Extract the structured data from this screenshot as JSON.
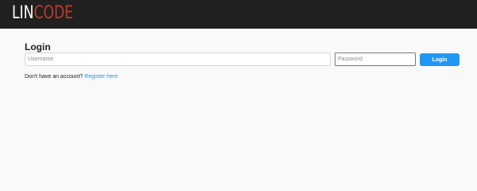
{
  "header": {
    "logo_part1": "LIN",
    "logo_part2": "CODE",
    "logo_colors": {
      "primary": "#ffffff",
      "accent": "#c0392b"
    },
    "background": "#202020"
  },
  "login": {
    "title": "Login",
    "username_placeholder": "Username",
    "username_value": "",
    "password_placeholder": "Password",
    "password_value": "",
    "button_label": "Login",
    "button_color": "#2196f3"
  },
  "register": {
    "prompt": "Don't have an account?",
    "link_text": "Register here",
    "link_color": "#2196f3"
  }
}
